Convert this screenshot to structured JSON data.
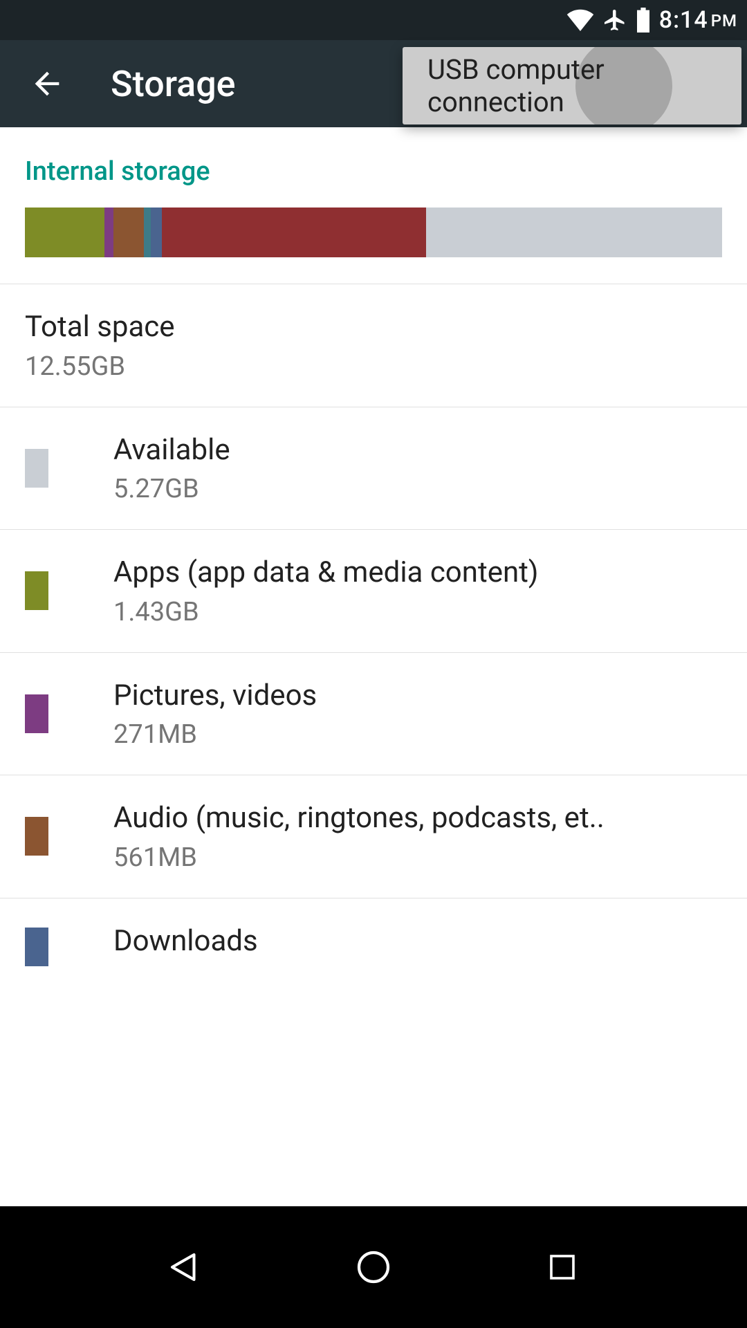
{
  "status": {
    "time": "8:14",
    "ampm": "PM"
  },
  "appbar": {
    "title": "Storage"
  },
  "menu": {
    "item0": "USB computer connection"
  },
  "section": {
    "header": "Internal storage"
  },
  "colors": {
    "apps": "#7e8c26",
    "pictures": "#7d3c82",
    "audio": "#8b5531",
    "misc1": "#3c7b88",
    "downloads": "#4a648f",
    "cached": "#8f2f31",
    "available": "#c9ced4"
  },
  "segments": [
    {
      "key": "apps",
      "pct": 11.4
    },
    {
      "key": "pictures",
      "pct": 1.3
    },
    {
      "key": "audio",
      "pct": 4.4
    },
    {
      "key": "misc1",
      "pct": 1.0
    },
    {
      "key": "downloads",
      "pct": 1.5
    },
    {
      "key": "cached",
      "pct": 37.9
    },
    {
      "key": "available",
      "pct": 42.5
    }
  ],
  "total": {
    "label": "Total space",
    "value": "12.55GB"
  },
  "rows": [
    {
      "label": "Available",
      "value": "5.27GB",
      "colorKey": "available"
    },
    {
      "label": "Apps (app data & media content)",
      "value": "1.43GB",
      "colorKey": "apps"
    },
    {
      "label": "Pictures, videos",
      "value": "271MB",
      "colorKey": "pictures"
    },
    {
      "label": "Audio (music, ringtones, podcasts, et..",
      "value": "561MB",
      "colorKey": "audio"
    },
    {
      "label": "Downloads",
      "value": "",
      "colorKey": "downloads"
    }
  ]
}
